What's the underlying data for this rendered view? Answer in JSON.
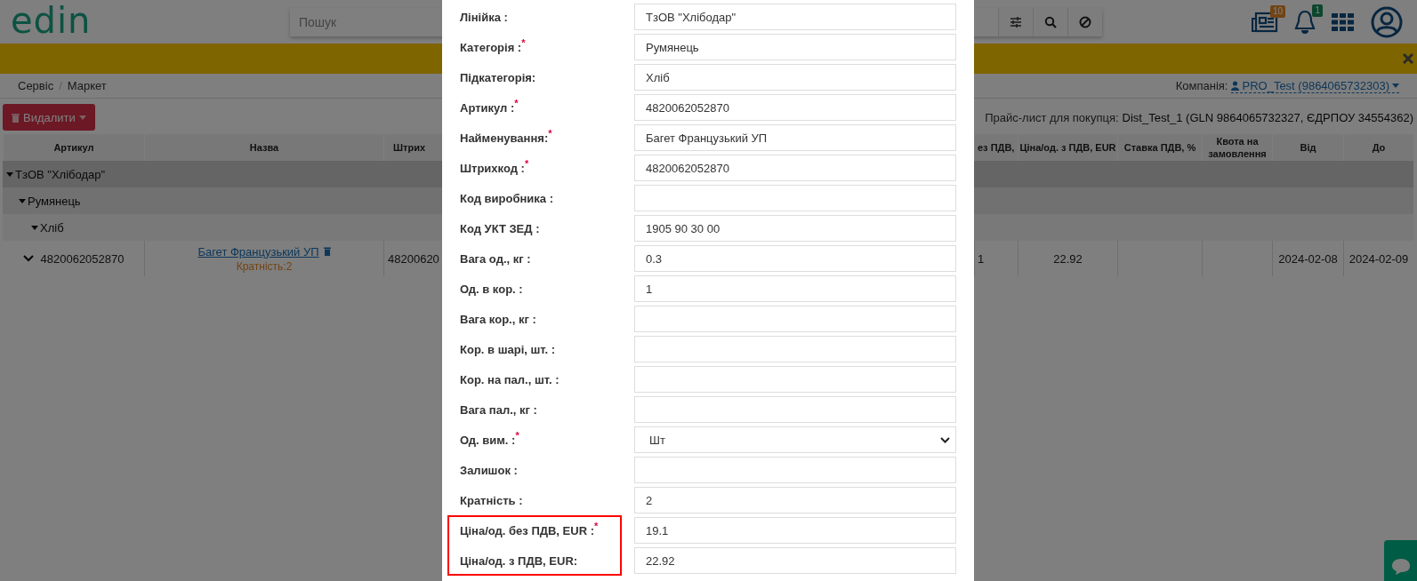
{
  "header": {
    "logo": "edin",
    "search": {
      "placeholder": "Пошук"
    },
    "news_badge": "10",
    "bell_badge": "1"
  },
  "breadcrumbs": {
    "items": [
      "Сервіс",
      "Маркет"
    ],
    "separator": "/"
  },
  "company": {
    "label": "Компанія:",
    "value": "PRO_Test (9864065732303)"
  },
  "delete_button": {
    "label": "Видалити"
  },
  "price_list": {
    "label": "Прайс-лист для покупця:",
    "value": "Dist_Test_1 (GLN 9864065732327, ЄДРПОУ 34554362)"
  },
  "table": {
    "columns": [
      "Артикул",
      "Назва",
      "Штрих",
      "ез ПДВ,",
      "Ціна/од. з ПДВ, EUR",
      "Ставка ПДВ, %",
      "Квота на замовлення",
      "Від",
      "До"
    ],
    "groups": [
      {
        "label": "ТзОВ \"Хлібодар\"",
        "expanded": true,
        "children": [
          {
            "label": "Румянець",
            "expanded": true,
            "children": [
              {
                "label": "Хліб",
                "expanded": true
              }
            ]
          }
        ]
      }
    ],
    "rows": [
      {
        "article": "4820062052870",
        "expanded": true,
        "name": "Багет Французький УП",
        "multiplicity": "Кратність:2",
        "barcode": "48200620",
        "price_net": "1",
        "price_gross": "22.92",
        "date_from": "2024-02-08",
        "date_to": "2024-02-09"
      }
    ]
  },
  "modal": {
    "required_mark": "*",
    "fields": [
      {
        "label": "Лінійка :",
        "kind": "text",
        "value": "ТзОВ \"Хлібодар\"",
        "required": false,
        "highlighted": false
      },
      {
        "label": "Категорія :",
        "kind": "text",
        "value": "Румянець",
        "required": true,
        "highlighted": false
      },
      {
        "label": "Підкатегорія:",
        "kind": "text",
        "value": "Хліб",
        "required": false,
        "highlighted": false
      },
      {
        "label": "Артикул :",
        "kind": "text",
        "value": "4820062052870",
        "required": true,
        "highlighted": false
      },
      {
        "label": "Найменування:",
        "kind": "text",
        "value": "Багет Французький УП",
        "required": true,
        "highlighted": false
      },
      {
        "label": "Штрихкод :",
        "kind": "text",
        "value": "4820062052870",
        "required": true,
        "highlighted": false
      },
      {
        "label": "Код виробника :",
        "kind": "text",
        "required": false,
        "highlighted": false
      },
      {
        "label": "Код УКТ ЗЕД :",
        "kind": "text",
        "value": "1905 90 30 00",
        "required": false,
        "highlighted": false
      },
      {
        "label": "Вага од., кг :",
        "kind": "text",
        "value": "0.3",
        "required": false,
        "highlighted": false
      },
      {
        "label": "Од. в кор. :",
        "kind": "text",
        "value": "1",
        "required": false,
        "highlighted": false
      },
      {
        "label": "Вага кор., кг :",
        "kind": "text",
        "required": false,
        "highlighted": false
      },
      {
        "label": "Кор. в шарі, шт. :",
        "kind": "text",
        "required": false,
        "highlighted": false
      },
      {
        "label": "Кор. на пал., шт. :",
        "kind": "text",
        "required": false,
        "highlighted": false
      },
      {
        "label": "Вага пал., кг :",
        "kind": "text",
        "required": false,
        "highlighted": false
      },
      {
        "label": "Од. вим. :",
        "kind": "select",
        "value": "Шт",
        "required": true,
        "highlighted": false
      },
      {
        "label": "Залишок :",
        "kind": "text",
        "required": false,
        "highlighted": false
      },
      {
        "label": "Кратність :",
        "kind": "text",
        "value": "2",
        "required": false,
        "highlighted": false
      },
      {
        "label": "Ціна/од. без ПДВ, EUR :",
        "kind": "text",
        "value": "19.1",
        "required": true,
        "highlighted": true
      },
      {
        "label": "Ціна/од. з ПДВ, EUR:",
        "kind": "text",
        "value": "22.92",
        "required": false,
        "highlighted": true
      }
    ]
  }
}
